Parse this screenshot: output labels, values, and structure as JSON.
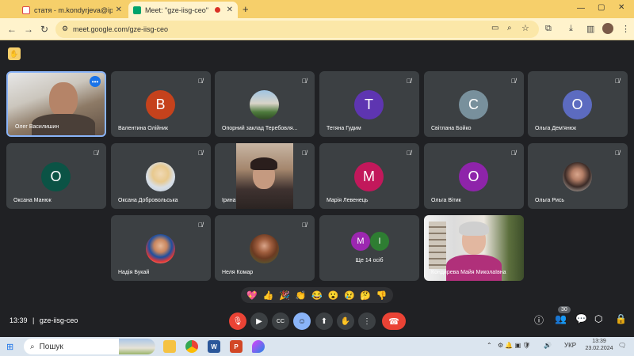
{
  "browser": {
    "tabs": [
      {
        "label": "статя - m.kondyrjeva@ippo.e..."
      },
      {
        "label": "Meet: \"gze-iisg-ceo\""
      }
    ],
    "url": "meet.google.com/gze-iisg-ceo",
    "new_tab_symbol": "+",
    "window_controls": [
      "—",
      "▢",
      "✕"
    ]
  },
  "meet": {
    "participants": [
      {
        "name": "Олег Василишин",
        "type": "video"
      },
      {
        "name": "Валентина Олійник",
        "type": "avatar",
        "letter": "B",
        "color": "#c5421c"
      },
      {
        "name": "Опорний заклад Теребовля...",
        "type": "photo"
      },
      {
        "name": "Тетяна Гудим",
        "type": "avatar",
        "letter": "T",
        "color": "#5e35b1"
      },
      {
        "name": "Світлана Бойко",
        "type": "avatar",
        "letter": "C",
        "color": "#78909c"
      },
      {
        "name": "Ольга Дем'янюк",
        "type": "avatar",
        "letter": "O",
        "color": "#5c6bc0"
      },
      {
        "name": "Оксана Манюк",
        "type": "avatar",
        "letter": "O",
        "color": "#0b5345"
      },
      {
        "name": "Оксана Добровольська",
        "type": "photo"
      },
      {
        "name": "Ірина",
        "type": "video"
      },
      {
        "name": "Марія Левенець",
        "type": "avatar",
        "letter": "M",
        "color": "#c2185b"
      },
      {
        "name": "Ольга Вітик",
        "type": "avatar",
        "letter": "O",
        "color": "#8e24aa"
      },
      {
        "name": "Ольга Рись",
        "type": "photo"
      },
      {
        "name": "Надія Букай",
        "type": "photo"
      },
      {
        "name": "Неля Комар",
        "type": "photo"
      },
      {
        "name": "Кондирева Майя Миколаївна",
        "type": "video"
      }
    ],
    "others": {
      "label": "Ще 14 осіб",
      "letters": [
        "M",
        "I"
      ],
      "colors": [
        "#9c27b0",
        "#2e7d32"
      ]
    },
    "reactions": [
      "💖",
      "👍",
      "🎉",
      "👏",
      "😂",
      "😮",
      "😢",
      "🤔",
      "👎"
    ],
    "time": "13:39",
    "separator": "|",
    "meeting_code": "gze-iisg-ceo",
    "participant_count": "30"
  },
  "taskbar": {
    "search_label": "Пошук",
    "language": "УКР",
    "clock_time": "13:39",
    "clock_date": "23.02.2024"
  }
}
